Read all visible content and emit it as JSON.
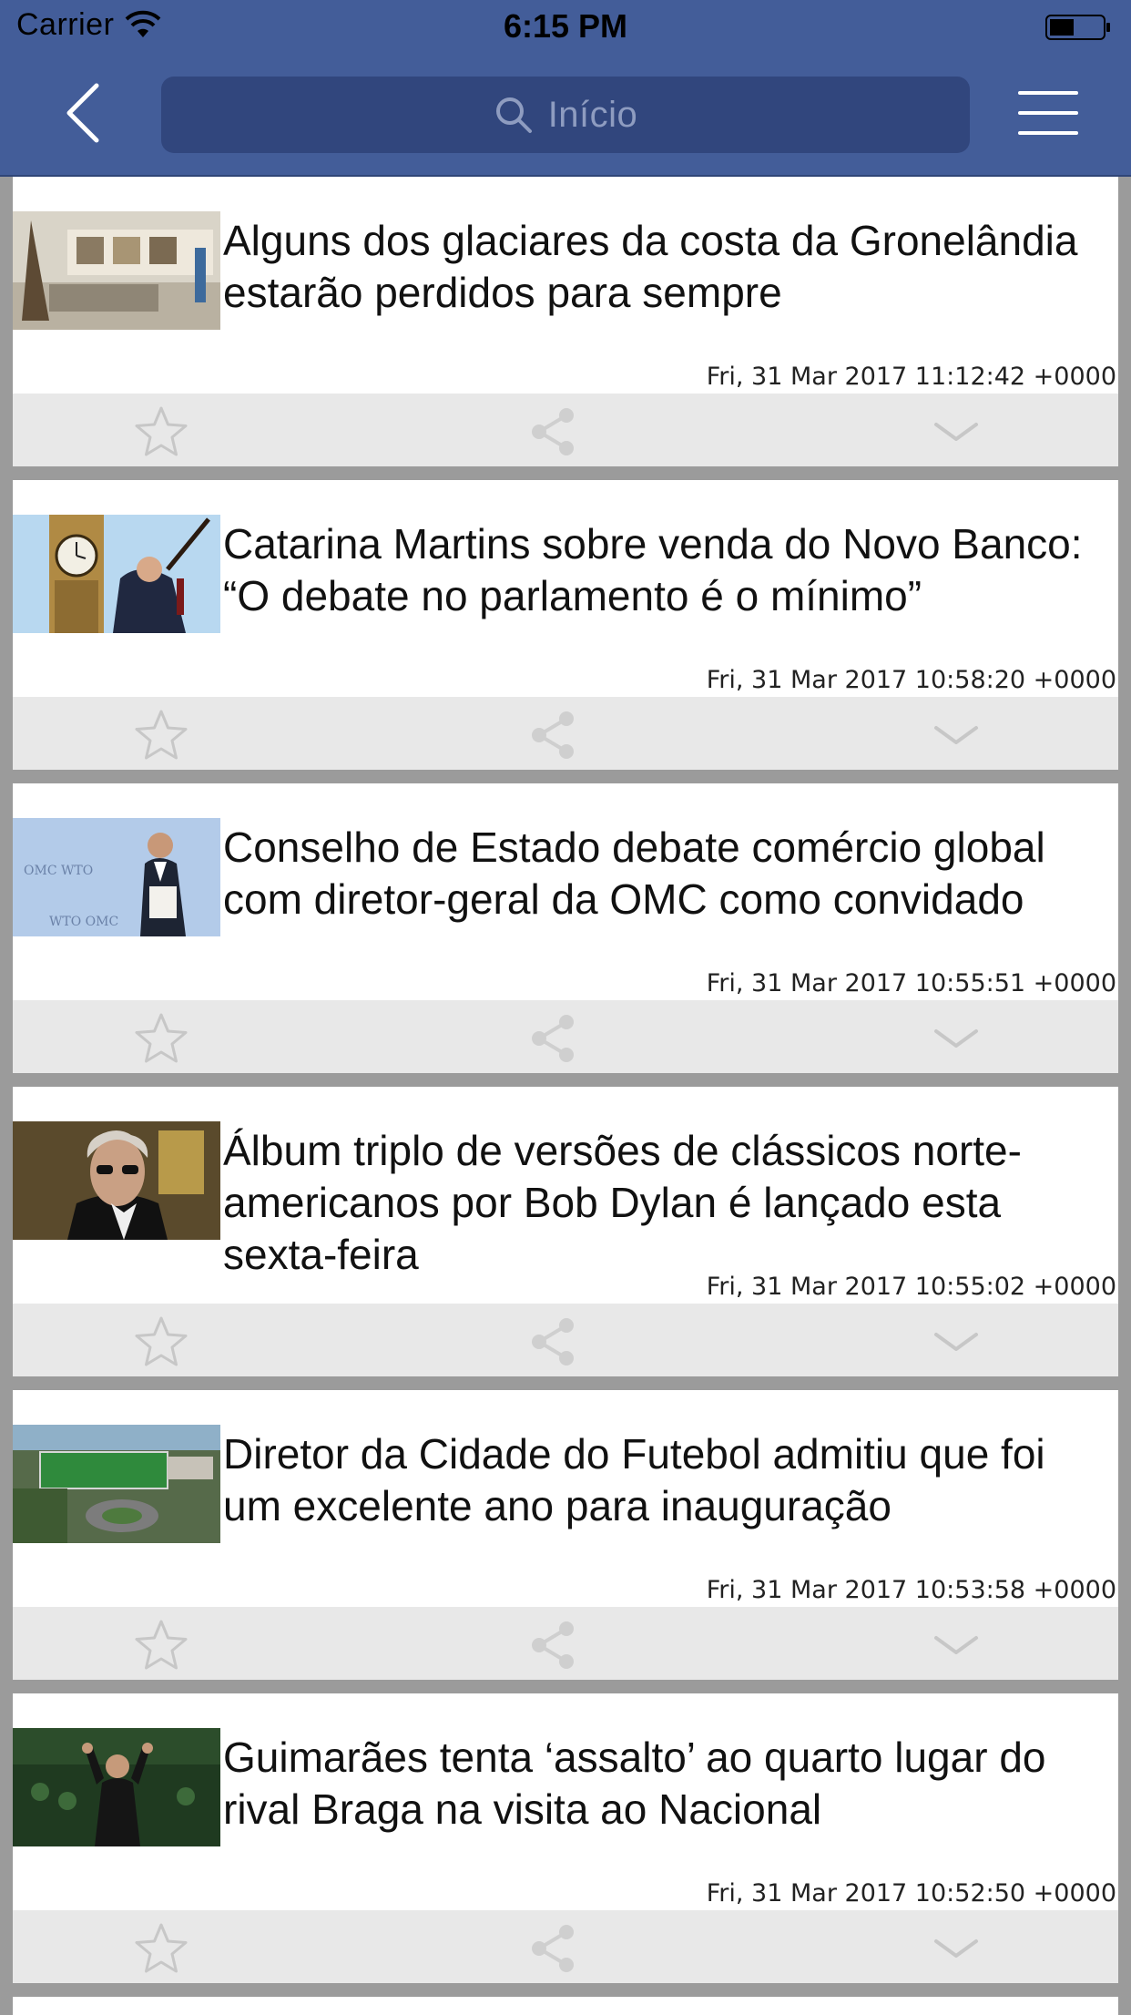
{
  "status_bar": {
    "carrier": "Carrier",
    "time": "6:15 PM"
  },
  "header": {
    "search_placeholder": "Início"
  },
  "icons": {
    "back": "chevron-left-icon",
    "search": "search-icon",
    "menu": "hamburger-menu-icon",
    "favorite": "star-outline-icon",
    "share": "share-icon",
    "more": "chevron-down-icon"
  },
  "colors": {
    "header": "#435d99",
    "search_field": "#31467d",
    "card": "#ffffff",
    "action_bar": "#e8e8e8",
    "background": "#9b9b9b"
  },
  "articles": [
    {
      "title": "Alguns dos glaciares da costa da Gronelândia estarão perdidos para sempre",
      "date": "Fri, 31 Mar 2017 11:12:42 +0000"
    },
    {
      "title": "Catarina Martins sobre venda do Novo Banco: “O debate no parlamento é o mínimo”",
      "date": "Fri, 31 Mar 2017 10:58:20 +0000"
    },
    {
      "title": "Conselho de Estado debate comércio global com diretor-geral da OMC como convidado",
      "date": "Fri, 31 Mar 2017 10:55:51 +0000"
    },
    {
      "title": "Álbum triplo de versões de clássicos norte-americanos por Bob Dylan é lançado esta sexta-feira",
      "date": "Fri, 31 Mar 2017 10:55:02 +0000"
    },
    {
      "title": "Diretor da Cidade do Futebol admitiu que foi um excelente ano para inauguração",
      "date": "Fri, 31 Mar 2017 10:53:58 +0000"
    },
    {
      "title": "Guimarães tenta ‘assalto’ ao quarto lugar do rival Braga na visita ao Nacional",
      "date": "Fri, 31 Mar 2017 10:52:50 +0000"
    }
  ]
}
